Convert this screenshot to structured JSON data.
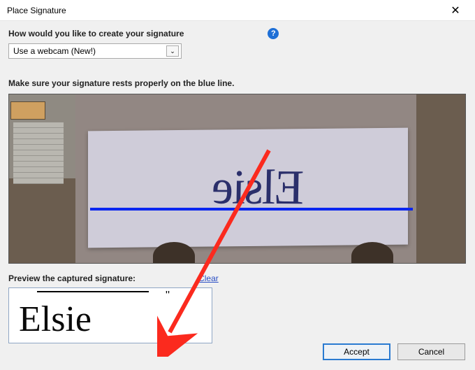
{
  "dialog": {
    "title": "Place Signature"
  },
  "prompts": {
    "create_label": "How would you like to create your signature",
    "instruction": "Make sure your signature rests properly on the blue line.",
    "preview_label": "Preview the captured signature:"
  },
  "dropdown": {
    "selected": "Use a webcam (New!)"
  },
  "links": {
    "clear": "Clear"
  },
  "buttons": {
    "accept": "Accept",
    "cancel": "Cancel"
  },
  "signature": {
    "captured_text": "Elsie",
    "webcam_mirrored_text": "Elsie"
  },
  "help": {
    "glyph": "?"
  },
  "close": {
    "glyph": "✕"
  }
}
